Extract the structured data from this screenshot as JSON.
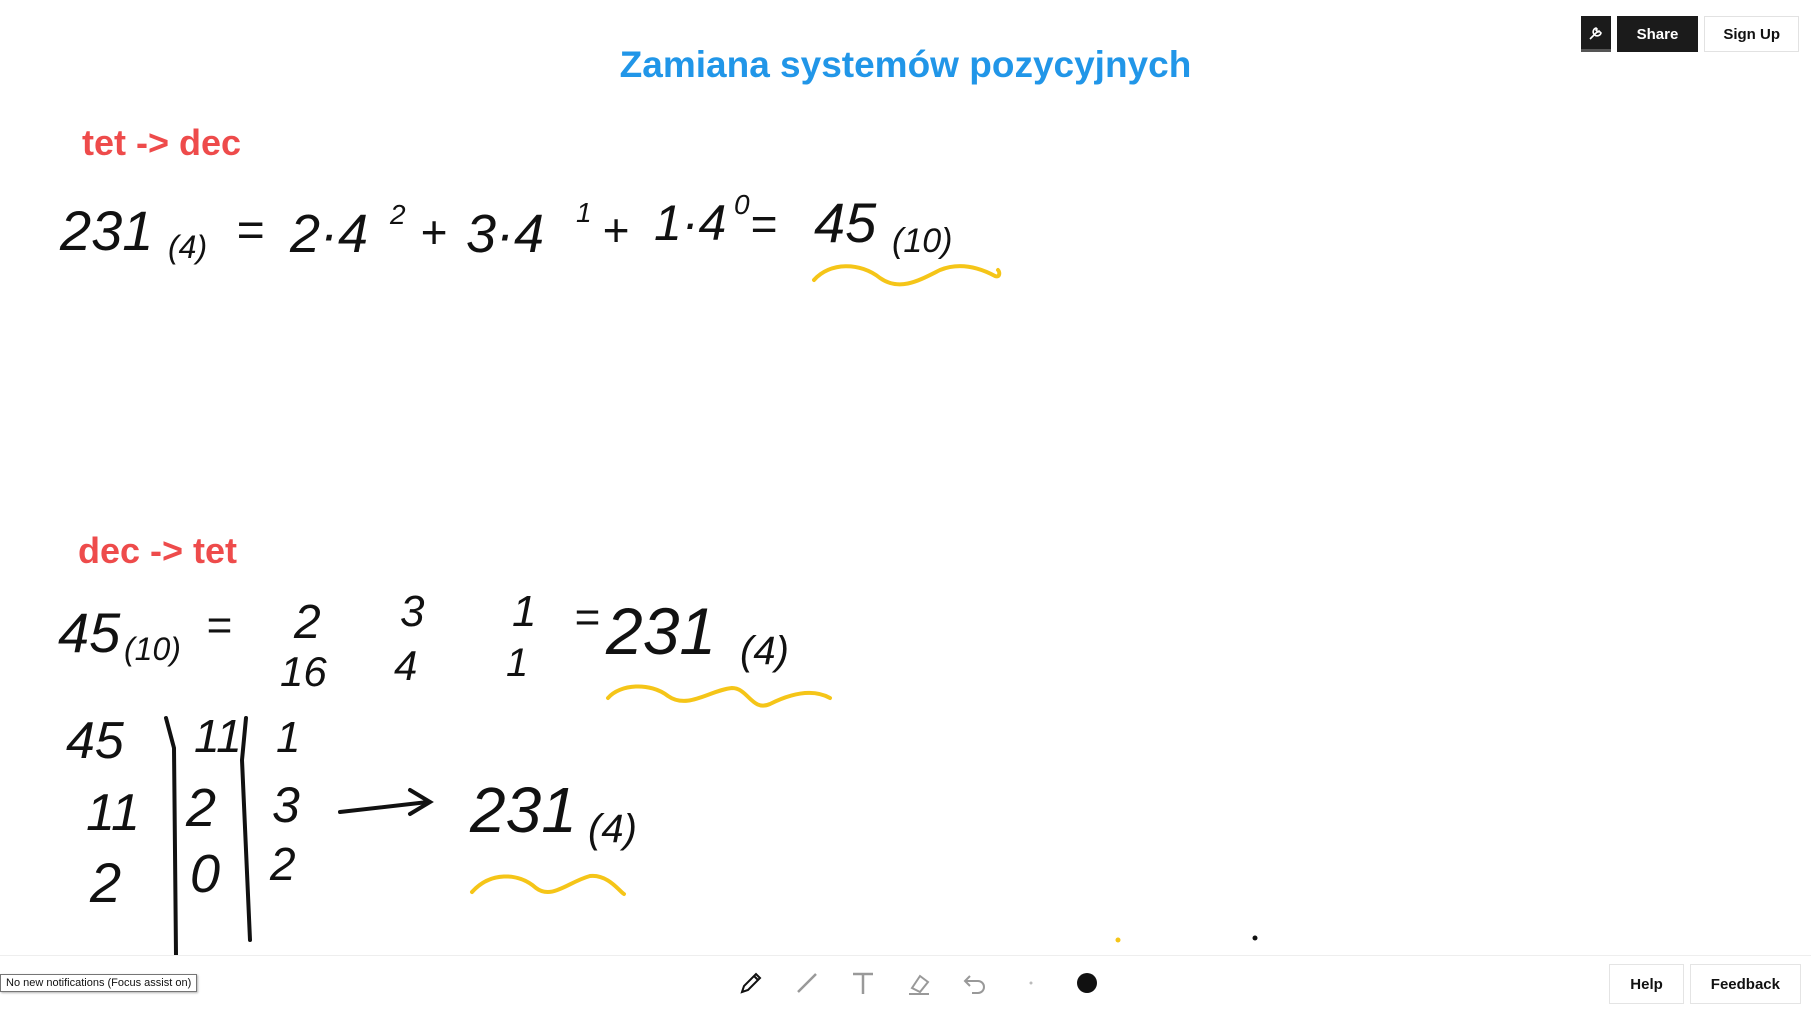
{
  "title": "Zamiana systemów pozycyjnych",
  "sections": {
    "tet_to_dec": "tet -> dec",
    "dec_to_tet": "dec -> tet"
  },
  "toolbar": {
    "share_label": "Share",
    "signup_label": "Sign Up"
  },
  "footer": {
    "help_label": "Help",
    "feedback_label": "Feedback",
    "notification": "No new notifications (Focus assist on)"
  },
  "colors": {
    "title": "#2196e8",
    "heading": "#ee4b4b",
    "ink": "#111111",
    "highlight": "#f5c518"
  },
  "handwriting": {
    "eq1": {
      "number": "231",
      "base": "(4)",
      "eq": "=",
      "t1": "2·4",
      "e1": "2",
      "plus1": "+",
      "t2": "3·4",
      "e2": "1",
      "plus2": "+",
      "t3": "1·4",
      "e3": "0",
      "eq2": "=",
      "result": "45",
      "result_base": "(10)"
    },
    "eq2": {
      "number": "45",
      "base": "(10)",
      "eq": "=",
      "digits": [
        "2",
        "3",
        "1"
      ],
      "weights": [
        "16",
        "4",
        "1"
      ],
      "eq2": "=",
      "result": "231",
      "result_base": "(4)"
    },
    "division": {
      "col1": [
        "45",
        "11",
        "2"
      ],
      "col2": [
        "11",
        "2",
        "0"
      ],
      "col3": [
        "1",
        "3",
        "2"
      ],
      "result": "231",
      "result_base": "(4)"
    }
  }
}
